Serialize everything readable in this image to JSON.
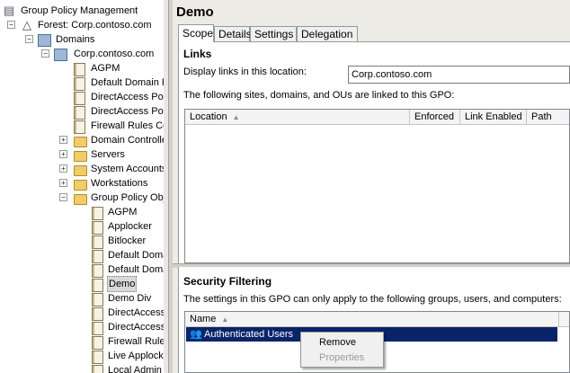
{
  "tree": {
    "root": "Group Policy Management",
    "forest": "Forest: Corp.contoso.com",
    "domains": "Domains",
    "domain": "Corp.contoso.com",
    "domain_children": [
      "AGPM",
      "Default Domain Po",
      "DirectAccess Polic",
      "DirectAccess Polic",
      "Firewall Rules Cor"
    ],
    "ous": [
      "Domain Controller",
      "Servers",
      "System Accounts",
      "Workstations"
    ],
    "gpo_folder": "Group Policy Obje",
    "gpos": [
      "AGPM",
      "Applocker",
      "Bitlocker",
      "Default Doma",
      "Default Doma",
      "Demo",
      "Demo Div",
      "DirectAccess",
      "DirectAccess",
      "Firewall Rules",
      "Live Applocke",
      "Local Admin"
    ],
    "selected_gpo": "Demo"
  },
  "details": {
    "title": "Demo",
    "tabs": [
      "Scope",
      "Details",
      "Settings",
      "Delegation"
    ],
    "active_tab": "Scope",
    "links": {
      "heading": "Links",
      "display_label": "Display links in this location:",
      "display_value": "Corp.contoso.com",
      "description": "The following sites, domains, and OUs are linked to this GPO:",
      "columns": [
        "Location",
        "Enforced",
        "Link Enabled",
        "Path"
      ]
    },
    "security": {
      "heading": "Security Filtering",
      "description": "The settings in this GPO can only apply to the following groups, users, and computers:",
      "column": "Name",
      "rows": [
        "Authenticated Users"
      ]
    }
  },
  "context_menu": {
    "items": [
      "Remove",
      "Properties"
    ]
  }
}
